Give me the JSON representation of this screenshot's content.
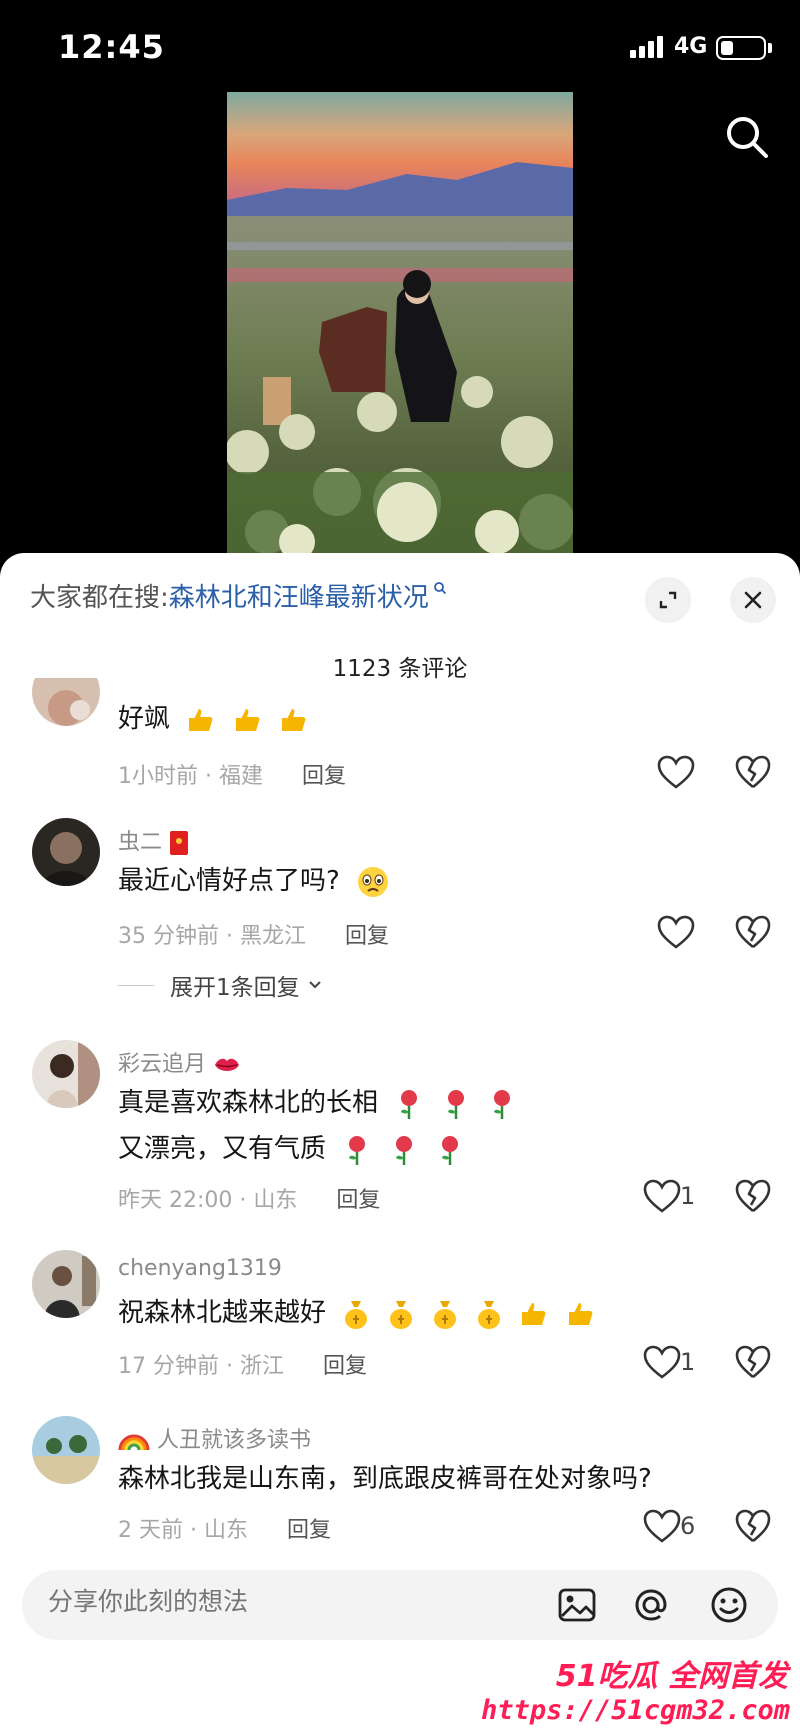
{
  "status_bar": {
    "time": "12:45",
    "network": "4G",
    "battery_level": 0.3
  },
  "search_suggestion": {
    "prefix": "大家都在搜:",
    "query": "森林北和汪峰最新状况"
  },
  "comment_count": "1123 条评论",
  "comments": [
    {
      "text": "好飒",
      "emoji": [
        "thumbs-up",
        "thumbs-up",
        "thumbs-up"
      ],
      "time": "1小时前",
      "location": "福建",
      "reply": "回复"
    },
    {
      "username": "虫二",
      "badge": "red-envelope",
      "text": "最近心情好点了吗?",
      "emoji": [
        "crying-face"
      ],
      "time": "35 分钟前",
      "location": "黑龙江",
      "reply": "回复",
      "expand": "展开1条回复"
    },
    {
      "username": "彩云追月",
      "badge": "lips",
      "text": "真是喜欢森林北的长相",
      "text2": "又漂亮，又有气质",
      "emoji": [
        "rose",
        "rose",
        "rose"
      ],
      "time": "昨天 22:00",
      "location": "山东",
      "reply": "回复",
      "likes": "1"
    },
    {
      "username": "chenyang1319",
      "text": "祝森林北越来越好",
      "emoji": [
        "money-bag",
        "money-bag",
        "money-bag",
        "money-bag",
        "thumbs-up",
        "thumbs-up"
      ],
      "time": "17 分钟前",
      "location": "浙江",
      "reply": "回复",
      "likes": "1"
    },
    {
      "username": "人丑就该多读书",
      "badge": "rainbow",
      "text": "森林北我是山东南，到底跟皮裤哥在处对象吗?",
      "time": "2 天前",
      "location": "山东",
      "reply": "回复",
      "likes": "6"
    }
  ],
  "input": {
    "placeholder": "分享你此刻的想法"
  },
  "watermark": {
    "line1": "51吃瓜 全网首发",
    "line2": "https://51cgm32.com"
  },
  "colors": {
    "link": "#2b5fa8",
    "watermark": "#ff1d55"
  }
}
